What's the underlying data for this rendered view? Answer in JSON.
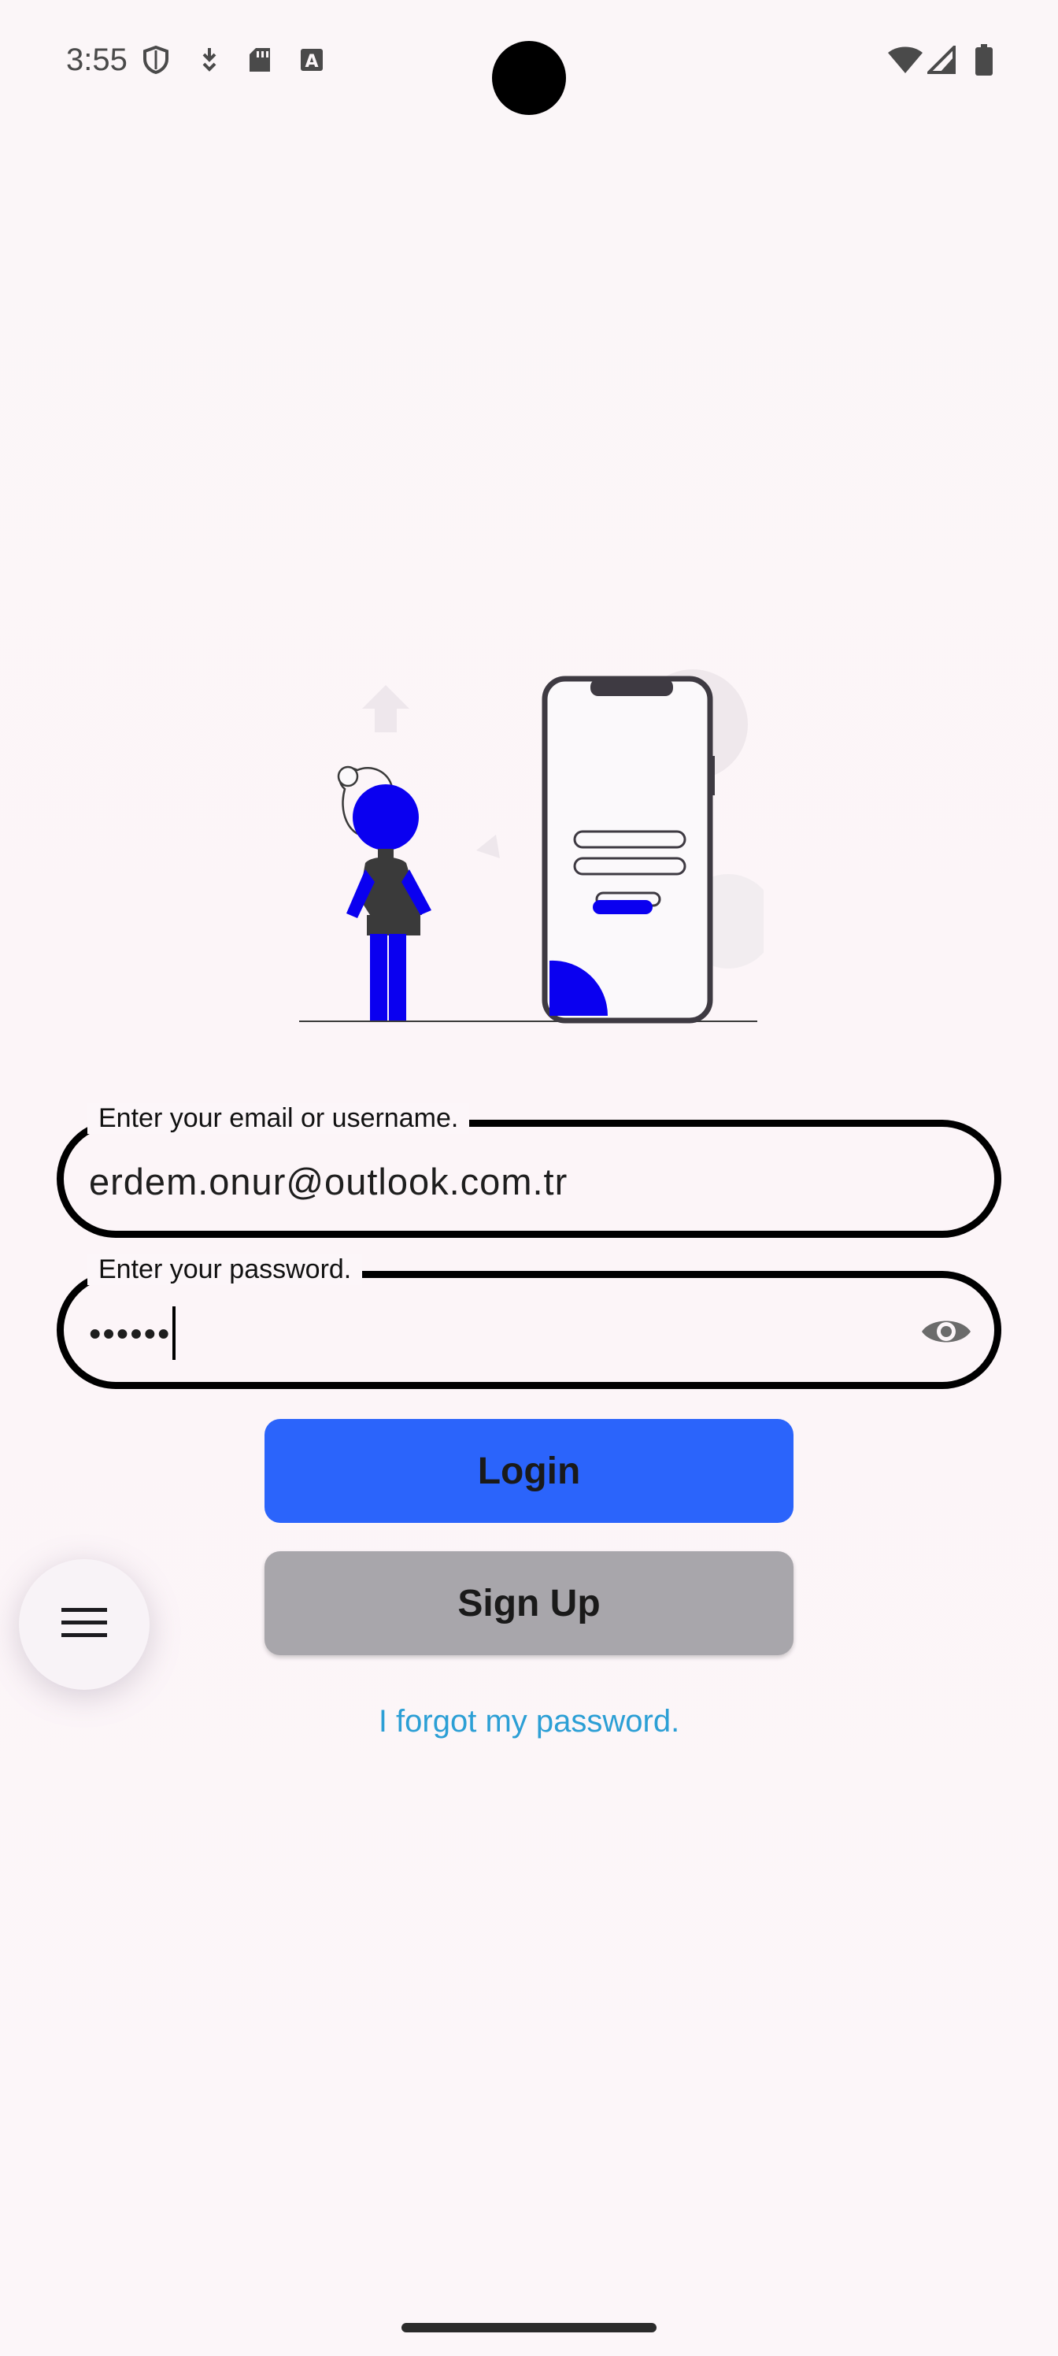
{
  "status_bar": {
    "time": "3:55",
    "left_icons": [
      "shield-icon",
      "download-icon",
      "sd-card-icon",
      "font-a-icon"
    ],
    "right_icons": [
      "wifi-icon",
      "cell-signal-icon",
      "battery-icon"
    ]
  },
  "illustration": {
    "name": "login-illustration"
  },
  "email_field": {
    "label": "Enter your email or username.",
    "value": "erdem.onur@outlook.com.tr"
  },
  "password_field": {
    "label": "Enter your password.",
    "value": "••••••",
    "toggle_icon": "eye-icon"
  },
  "buttons": {
    "login": "Login",
    "signup": "Sign Up"
  },
  "links": {
    "forgot_password": "I forgot my password."
  },
  "fab": {
    "icon": "menu-icon"
  },
  "colors": {
    "background": "#fcf6f9",
    "login_button": "#2b64fb",
    "signup_button": "#a8a6ab",
    "link": "#2c9fd5",
    "illustration_accent": "#0a00f0"
  }
}
